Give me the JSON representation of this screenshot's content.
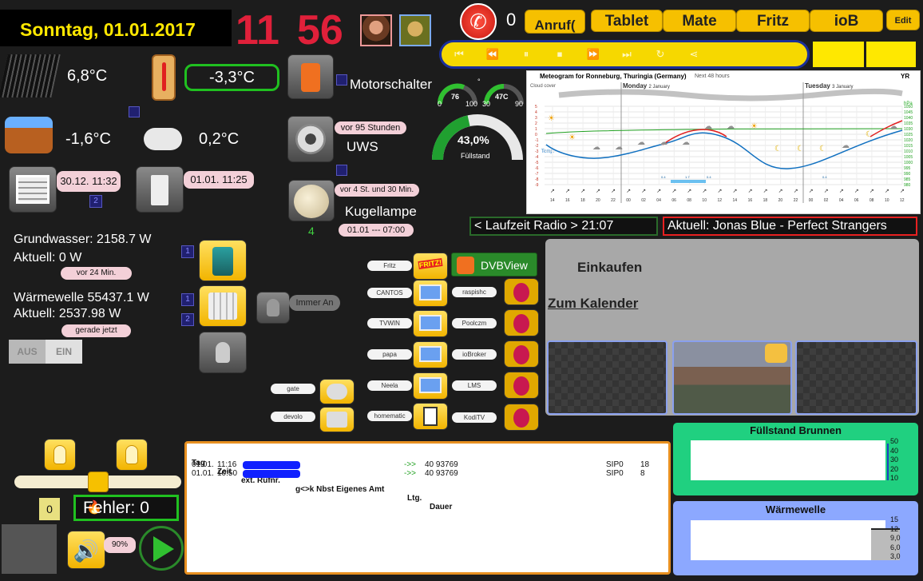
{
  "date": "Sonntag, 01.01.2017",
  "clock": {
    "hours": "11",
    "minutes": "56"
  },
  "calls": {
    "count": "0",
    "anruf_label": "Anruf(",
    "tabs": [
      "Tablet",
      "Mate",
      "Fritz",
      "ioB"
    ],
    "edit_label": "Edit"
  },
  "temps": {
    "pool_solar": "6,8°C",
    "outside": "-3,3°C",
    "whirlpool": "-1,6°C",
    "cloud": "0,2°C"
  },
  "motor": {
    "label": "Motorschalter"
  },
  "uws": {
    "time": "vor 95 Stunden",
    "label": "UWS"
  },
  "kugellampe": {
    "time": "vor 4 St. und 30 Min.",
    "label": "Kugellampe",
    "count": "4",
    "schedule": "01.01 --- 07:00"
  },
  "garage": {
    "time": "30.12. 11:32",
    "badge": "2"
  },
  "door": {
    "time": "01.01. 11:25"
  },
  "gauges": {
    "g1_value": "76",
    "g1_min": "0",
    "g1_max": "100",
    "g2_value": "47C",
    "g2_min": "30",
    "g2_max": "90",
    "unit": "°",
    "tank_value": "43,0%",
    "tank_label": "Füllstand",
    "tank_fraction": 0.43
  },
  "meteogram": {
    "title": "Meteogram for Ronneburg, Thuringia (Germany)",
    "subtitle": "Next 48 hours",
    "logo": "YR",
    "cloud_label": "Cloud cover",
    "day1": "Monday",
    "day1_date": "2 January",
    "day2": "Tuesday",
    "day2_date": "3 January",
    "temp_label": "Temp.",
    "hpa_label": "hPa",
    "left_ticks": [
      "5",
      "4",
      "3",
      "2",
      "1",
      "0",
      "-1",
      "-2",
      "-3",
      "-4",
      "-5",
      "-6",
      "-7",
      "-8",
      "-9"
    ],
    "right_ticks": [
      "1050",
      "1045",
      "1040",
      "1035",
      "1030",
      "1025",
      "1020",
      "1015",
      "1010",
      "1005",
      "1000",
      "995",
      "990",
      "985",
      "980"
    ],
    "hours": [
      "14",
      "16",
      "18",
      "20",
      "22",
      "00",
      "02",
      "04",
      "06",
      "08",
      "10",
      "12",
      "14",
      "16",
      "18",
      "20",
      "22",
      "00",
      "02",
      "04",
      "06",
      "08",
      "10",
      "12"
    ],
    "precip": [
      "0.4",
      "1.7",
      "0.4",
      "0.4"
    ]
  },
  "radio": {
    "runtime": "< Laufzeit Radio > 21:07",
    "now_playing": "Aktuell: Jonas Blue - Perfect Strangers"
  },
  "grundwasser": {
    "total": "Grundwasser: 2158.7 W",
    "now": "Aktuell: 0 W",
    "time": "vor 24 Min.",
    "badge": "1"
  },
  "waermewelle": {
    "total": "Wärmewelle 55437.1 W",
    "now": "Aktuell: 2537.98 W",
    "time": "gerade jetzt",
    "badge1": "1",
    "badge2": "2"
  },
  "immer_an": "Immer An",
  "aus_ein": {
    "aus": "AUS",
    "ein": "EIN"
  },
  "devices_left": [
    "Fritz",
    "CANTOS",
    "TVWIN",
    "papa",
    "Neela",
    "homematic"
  ],
  "devices_right": [
    "DVBView",
    "raspishc",
    "Poolczm",
    "ioBroker",
    "LMS",
    "KodiTV"
  ],
  "devices_far": [
    "gate",
    "devolo"
  ],
  "fritz_logo": "FRITZ!",
  "shopping": {
    "einkaufen": "Einkaufen",
    "kalender": "Zum Kalender"
  },
  "calllist": {
    "headers": [
      "Tag",
      "Zeit",
      "ext. Rufnr.",
      "g<>k Nbst Eigenes Amt",
      "Ltg.",
      "Dauer"
    ],
    "rows": [
      {
        "tag": "01.01.",
        "zeit": "11:16",
        "dir": "->>",
        "amt": "40 93769",
        "ltg": "SIP0",
        "dauer": "18"
      },
      {
        "tag": "01.01.",
        "zeit": "10:50",
        "dir": "->>",
        "amt": "40 93769",
        "ltg": "SIP0",
        "dauer": "8"
      }
    ]
  },
  "dimmer": {
    "value": "0",
    "fraction": 0.5
  },
  "fehler": "Fehler: 0",
  "volume": "90%",
  "brunnen": {
    "title": "Füllstand Brunnen",
    "ticks": [
      "50",
      "40",
      "30",
      "20",
      "10"
    ]
  },
  "wave_chart": {
    "title": "Wärmewelle",
    "ticks": [
      "15",
      "12",
      "9,0",
      "6,0",
      "3,0"
    ]
  },
  "colors": {
    "accent_yellow": "#f6c000",
    "clock_red": "#e0203a",
    "green": "#3ab03a",
    "radio_red": "#e82020"
  }
}
